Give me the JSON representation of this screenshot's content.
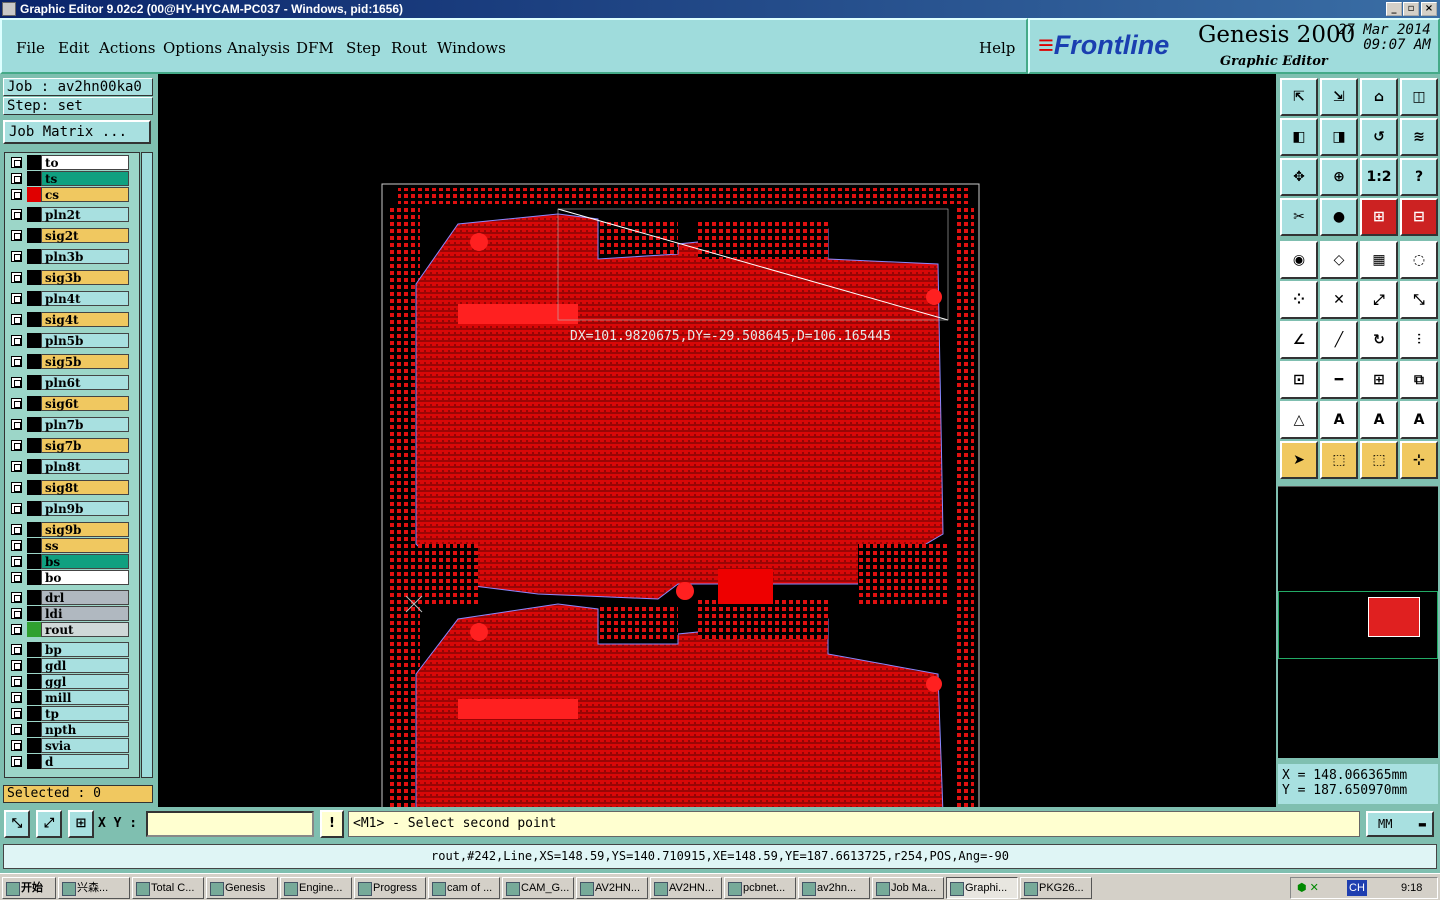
{
  "window": {
    "title": "Graphic Editor 9.02c2 (00@HY-HYCAM-PC037 - Windows, pid:1656)"
  },
  "menu": [
    "File",
    "Edit",
    "Actions",
    "Options",
    "Analysis",
    "DFM",
    "Step",
    "Rout",
    "Windows"
  ],
  "help": "Help",
  "brand": {
    "logo": "Frontline",
    "product": "Genesis 2000",
    "sub": "Graphic Editor",
    "date": "27 Mar 2014",
    "time": "09:07 AM"
  },
  "job": "Job : av2hn00ka0",
  "step": "Step: set",
  "job_matrix": "Job Matrix ...",
  "layers": [
    {
      "name": "to",
      "color": "#ffffff",
      "sw": "#000000"
    },
    {
      "name": "ts",
      "color": "#10a080",
      "sw": "#000000"
    },
    {
      "name": "cs",
      "color": "#f0c860",
      "sw": "#e00000"
    },
    {
      "name": "pln2t",
      "color": "#a8e0e0",
      "sw": "#000000"
    },
    {
      "name": "sig2t",
      "color": "#f0c860",
      "sw": "#000000"
    },
    {
      "name": "pln3b",
      "color": "#a8e0e0",
      "sw": "#000000"
    },
    {
      "name": "sig3b",
      "color": "#f0c860",
      "sw": "#000000"
    },
    {
      "name": "pln4t",
      "color": "#a8e0e0",
      "sw": "#000000"
    },
    {
      "name": "sig4t",
      "color": "#f0c860",
      "sw": "#000000"
    },
    {
      "name": "pln5b",
      "color": "#a8e0e0",
      "sw": "#000000"
    },
    {
      "name": "sig5b",
      "color": "#f0c860",
      "sw": "#000000"
    },
    {
      "name": "pln6t",
      "color": "#a8e0e0",
      "sw": "#000000"
    },
    {
      "name": "sig6t",
      "color": "#f0c860",
      "sw": "#000000"
    },
    {
      "name": "pln7b",
      "color": "#a8e0e0",
      "sw": "#000000"
    },
    {
      "name": "sig7b",
      "color": "#f0c860",
      "sw": "#000000"
    },
    {
      "name": "pln8t",
      "color": "#a8e0e0",
      "sw": "#000000"
    },
    {
      "name": "sig8t",
      "color": "#f0c860",
      "sw": "#000000"
    },
    {
      "name": "pln9b",
      "color": "#a8e0e0",
      "sw": "#000000"
    },
    {
      "name": "sig9b",
      "color": "#f0c860",
      "sw": "#000000"
    },
    {
      "name": "ss",
      "color": "#f0c860",
      "sw": "#000000"
    },
    {
      "name": "bs",
      "color": "#10a080",
      "sw": "#000000"
    },
    {
      "name": "bo",
      "color": "#ffffff",
      "sw": "#000000"
    },
    {
      "name": "drl",
      "color": "#b0b8c0",
      "sw": "#000000"
    },
    {
      "name": "ldi",
      "color": "#b0b8c0",
      "sw": "#000000"
    },
    {
      "name": "rout",
      "color": "#d0d8d8",
      "sw": "#30a030"
    },
    {
      "name": "bp",
      "color": "#a8e0e0",
      "sw": "#000000"
    },
    {
      "name": "gdl",
      "color": "#a8e0e0",
      "sw": "#000000"
    },
    {
      "name": "ggl",
      "color": "#a8e0e0",
      "sw": "#000000"
    },
    {
      "name": "mill",
      "color": "#a8e0e0",
      "sw": "#000000"
    },
    {
      "name": "tp",
      "color": "#a8e0e0",
      "sw": "#000000"
    },
    {
      "name": "npth",
      "color": "#a8e0e0",
      "sw": "#000000"
    },
    {
      "name": "svia",
      "color": "#a8e0e0",
      "sw": "#000000"
    },
    {
      "name": "d",
      "color": "#a8e0e0",
      "sw": "#000000"
    }
  ],
  "selected": "Selected : 0",
  "measure": "DX=101.9820675,DY=-29.508645,D=106.165445",
  "coords": {
    "x": "X  = 148.066365mm",
    "y": "Y  = 187.650970mm"
  },
  "xy_label": "X Y :",
  "prompt": "<M1> - Select second point",
  "units": "MM",
  "status": "rout,#242,Line,XS=148.59,YS=140.710915,XE=148.59,YE=187.6613725,r254,POS,Ang=-90",
  "toolbar": [
    "⇱",
    "⇲",
    "⌂",
    "◫",
    "◧",
    "◨",
    "↺",
    "≋",
    "✥",
    "⊕",
    "1:2",
    "?",
    "✂",
    "●",
    "⊞",
    "⊟",
    "◉",
    "◇",
    "▦",
    "◌",
    "⁘",
    "✕",
    "⤢",
    "⤡",
    "∠",
    "╱",
    "↻",
    "⫶",
    "⊡",
    "━",
    "⊞",
    "⧉",
    "△",
    "A",
    "A",
    "A",
    "➤",
    "⬚",
    "⬚",
    "⊹"
  ],
  "taskbar": {
    "start": "开始",
    "tasks": [
      "兴森...",
      "Total C...",
      "Genesis",
      "Engine...",
      "Progress",
      "cam of ...",
      "CAM_G...",
      "AV2HN...",
      "AV2HN...",
      "pcbnet...",
      "av2hn...",
      "Job Ma...",
      "Graphi...",
      "PKG26..."
    ],
    "active": "Graphi...",
    "clock": "9:18",
    "tray": "CH"
  }
}
